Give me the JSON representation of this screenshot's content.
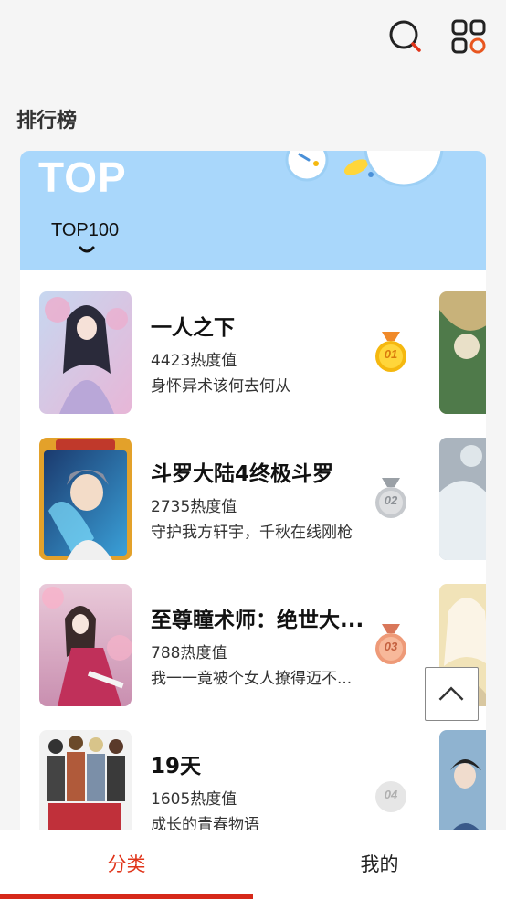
{
  "header": {
    "search_icon": "search-icon",
    "menu_icon": "grid-menu-icon"
  },
  "section_title": "排行榜",
  "ranking": {
    "banner_label": "TOP",
    "tabs": [
      {
        "label": "TOP100",
        "selected": true
      }
    ],
    "items": [
      {
        "rank_label": "01",
        "title": "一人之下",
        "heat": "4423热度值",
        "description": "身怀异术该何去何从",
        "medal": "gold"
      },
      {
        "rank_label": "02",
        "title": "斗罗大陆4终极斗罗",
        "heat": "2735热度值",
        "description": "守护我方轩宇，千秋在线刚枪",
        "medal": "silver"
      },
      {
        "rank_label": "03",
        "title": "至尊瞳术师：绝世大...",
        "heat": "788热度值",
        "description": "我一一竟被个女人撩得迈不...",
        "medal": "bronze"
      },
      {
        "rank_label": "04",
        "title": "19天",
        "heat": "1605热度值",
        "description": "成长的青春物语",
        "medal": "plain"
      }
    ]
  },
  "back_to_top_icon": "chevron-up-icon",
  "bottom_nav": {
    "items": [
      {
        "label": "分类",
        "active": true
      },
      {
        "label": "我的",
        "active": false
      }
    ]
  },
  "colors": {
    "accent": "#e0341a",
    "banner": "#a9d7fb",
    "gold": "#f5b80f",
    "silver": "#b9bcc0",
    "bronze": "#f0a07a"
  }
}
